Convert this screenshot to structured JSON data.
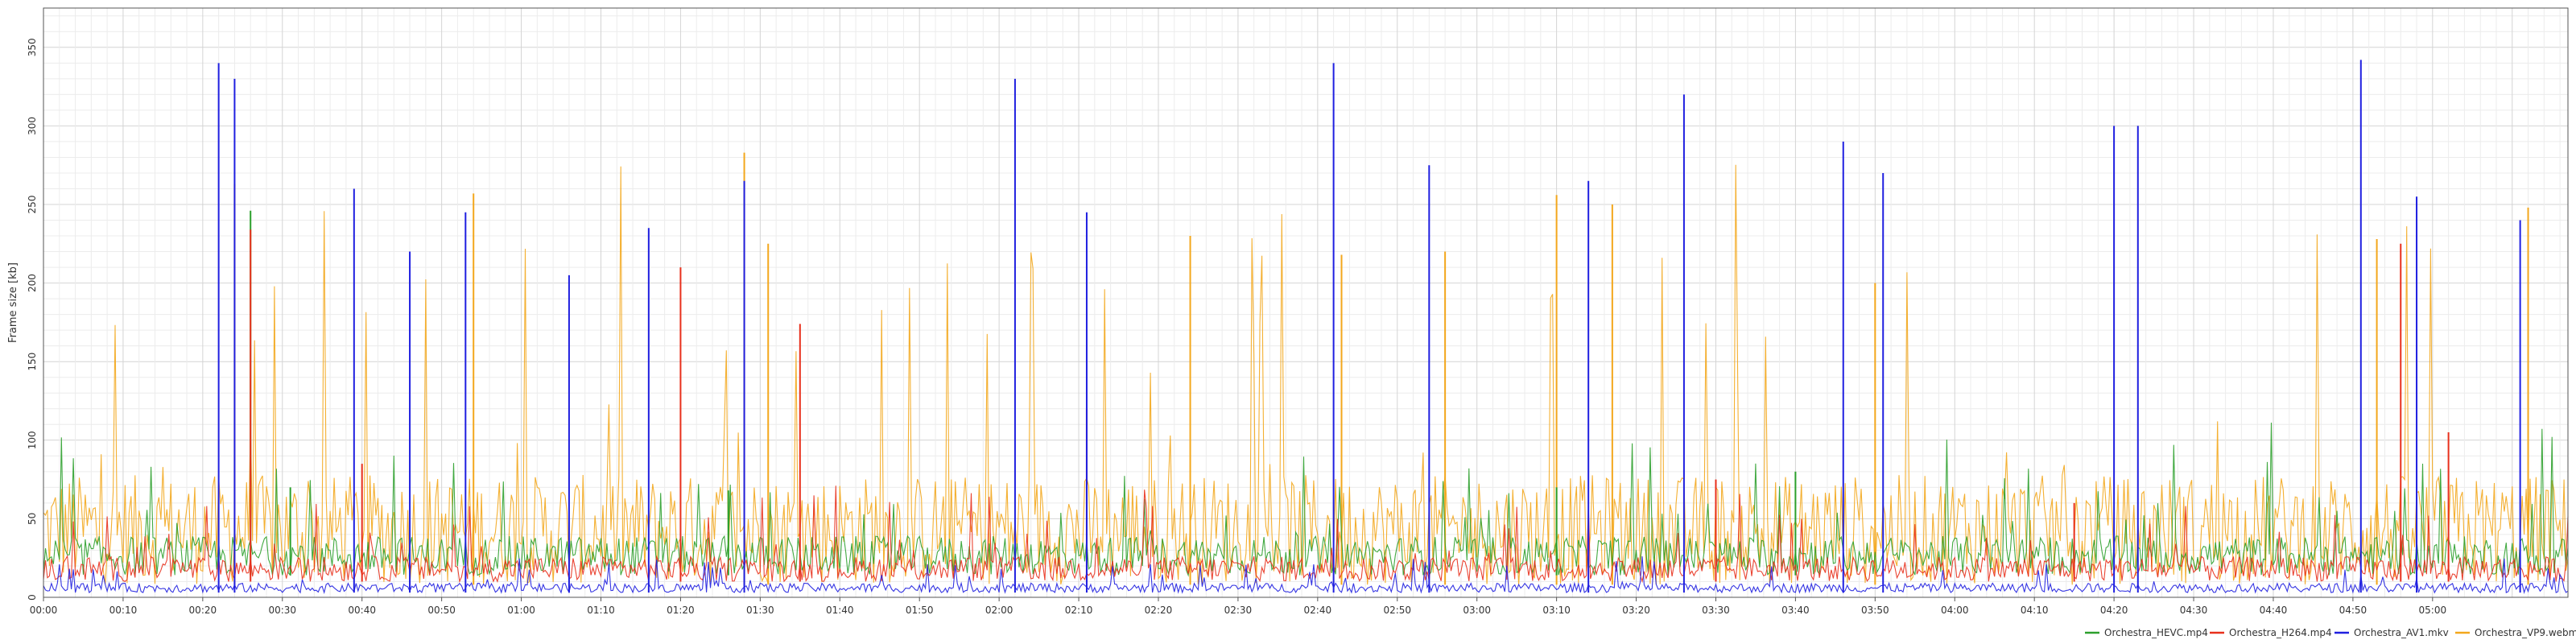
{
  "chart_data": {
    "type": "line",
    "ylabel": "Frame size [kb]",
    "xlabel": "",
    "title": "",
    "ylim": [
      0,
      375
    ],
    "y_ticks": [
      0,
      50,
      100,
      150,
      200,
      250,
      300,
      350
    ],
    "x_unit": "seconds",
    "xlim": [
      0,
      317
    ],
    "x_ticks": [
      "00:00",
      "00:10",
      "00:20",
      "00:30",
      "00:40",
      "00:50",
      "01:00",
      "01:10",
      "01:20",
      "01:30",
      "01:40",
      "01:50",
      "02:00",
      "02:10",
      "02:20",
      "02:30",
      "02:40",
      "02:50",
      "03:00",
      "03:10",
      "03:20",
      "03:30",
      "03:40",
      "03:50",
      "04:00",
      "04:10",
      "04:20",
      "04:30",
      "04:40",
      "04:50",
      "05:00"
    ],
    "grid": true,
    "legend_position": "bottom-right",
    "series": [
      {
        "name": "Orchestra_HEVC.mp4",
        "color": "#2ca02c",
        "base": 14,
        "avg_var": 25,
        "peaks": [
          [
            26,
            246
          ],
          [
            31,
            70
          ],
          [
            86,
            68
          ],
          [
            190,
            70
          ],
          [
            220,
            80
          ]
        ]
      },
      {
        "name": "Orchestra_H264.mp4",
        "color": "#e8301c",
        "base": 10,
        "avg_var": 16,
        "peaks": [
          [
            26,
            234
          ],
          [
            40,
            85
          ],
          [
            80,
            210
          ],
          [
            95,
            174
          ],
          [
            131,
            120
          ],
          [
            210,
            75
          ],
          [
            255,
            60
          ],
          [
            296,
            225
          ],
          [
            302,
            105
          ]
        ]
      },
      {
        "name": "Orchestra_AV1.mkv",
        "color": "#1f1fe0",
        "base": 3,
        "avg_var": 6,
        "peaks": [
          [
            22,
            340
          ],
          [
            24,
            330
          ],
          [
            39,
            260
          ],
          [
            46,
            220
          ],
          [
            53,
            245
          ],
          [
            66,
            205
          ],
          [
            76,
            235
          ],
          [
            88,
            265
          ],
          [
            122,
            330
          ],
          [
            131,
            245
          ],
          [
            162,
            340
          ],
          [
            174,
            275
          ],
          [
            194,
            265
          ],
          [
            206,
            320
          ],
          [
            226,
            290
          ],
          [
            231,
            270
          ],
          [
            260,
            300
          ],
          [
            263,
            300
          ],
          [
            291,
            342
          ],
          [
            298,
            255
          ],
          [
            311,
            240
          ]
        ]
      },
      {
        "name": "Orchestra_VP9.webm",
        "color": "#f3a71c",
        "base": 8,
        "avg_var": 70,
        "peaks": [
          [
            24,
            263
          ],
          [
            54,
            257
          ],
          [
            88,
            283
          ],
          [
            91,
            225
          ],
          [
            144,
            230
          ],
          [
            163,
            218
          ],
          [
            176,
            220
          ],
          [
            190,
            256
          ],
          [
            197,
            250
          ],
          [
            230,
            200
          ],
          [
            293,
            228
          ],
          [
            312,
            248
          ]
        ]
      }
    ]
  }
}
